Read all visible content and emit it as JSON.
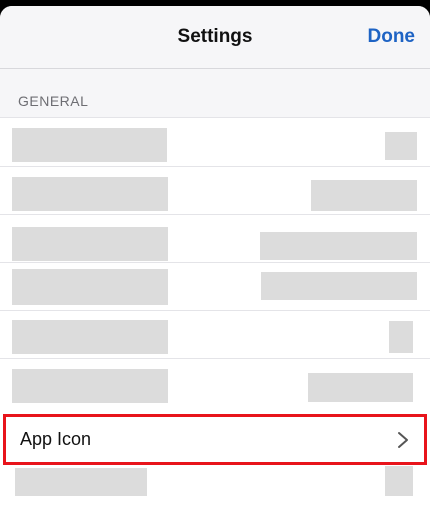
{
  "header": {
    "title": "Settings",
    "done_label": "Done"
  },
  "section": {
    "title": "GENERAL"
  },
  "rows": {
    "app_icon_label": "App Icon"
  },
  "colors": {
    "accent": "#1e63c4",
    "highlight_border": "#e8141b",
    "placeholder": "#dcdcdc"
  },
  "icons": {
    "chevron": "chevron-right-icon"
  }
}
